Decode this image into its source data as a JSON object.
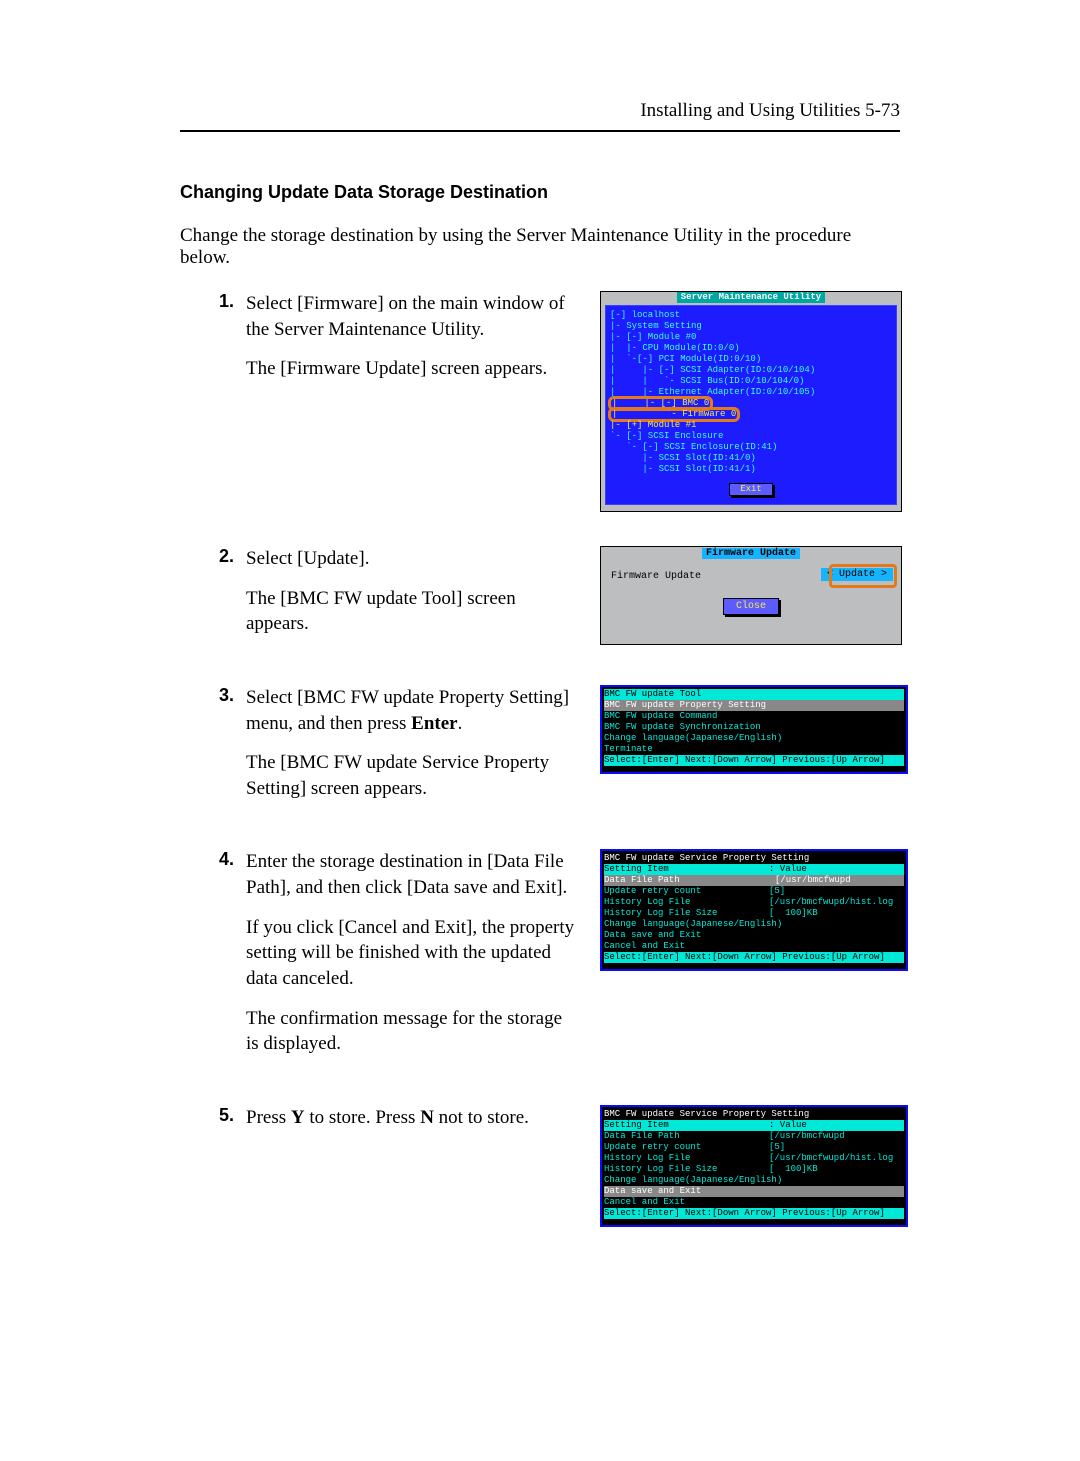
{
  "header": {
    "text": "Installing and Using Utilities    5-73"
  },
  "section_title": "Changing Update Data Storage Destination",
  "intro": "Change the storage destination by using the Server Maintenance Utility in the procedure below.",
  "steps": [
    {
      "num": "1.",
      "paras": [
        "Select [Firmware] on the main window of the Server Maintenance Utility.",
        "The [Firmware Update] screen appears."
      ]
    },
    {
      "num": "2.",
      "paras": [
        "Select [Update].",
        "The [BMC FW update Tool] screen appears."
      ]
    },
    {
      "num": "3.",
      "paras": [
        "Select [BMC FW update Property Setting] menu, and then press Enter.",
        "The [BMC FW update Service Property Setting] screen appears."
      ]
    },
    {
      "num": "4.",
      "paras": [
        "Enter the storage destination in [Data File Path], and then click [Data save and Exit].",
        "If you click [Cancel and Exit], the property setting will be finished with the updated data canceled.",
        "The confirmation message for the storage is displayed."
      ]
    },
    {
      "num": "5.",
      "paras": [
        "Press Y to store. Press N not to store."
      ]
    }
  ],
  "fig1": {
    "title": " Server Maintenance Utility ",
    "exit": "Exit",
    "tree": [
      {
        "txt": "[-] localhost",
        "cls": "tcy"
      },
      {
        "txt": "|- System Setting",
        "cls": "tcy"
      },
      {
        "txt": "|- [-] Module #0",
        "cls": "tcy"
      },
      {
        "txt": "|  |- CPU Module(ID:0/0)",
        "cls": "tcy"
      },
      {
        "txt": "|  `-[-] PCI Module(ID:0/10)",
        "cls": "tcy"
      },
      {
        "txt": "|     |- [-] SCSI Adapter(ID:0/10/104)",
        "cls": "tcy"
      },
      {
        "txt": "|     |   `- SCSI Bus(ID:0/10/104/0)",
        "cls": "tcy"
      },
      {
        "txt": "|     |- Ethernet Adapter(ID:0/10/105)",
        "cls": "tcy"
      },
      {
        "txt": "|     |- [-] BMC 0",
        "cls": "ty",
        "hl": true
      },
      {
        "txt": "|         `- Firmware 0",
        "cls": "ty",
        "hl_cont": true
      },
      {
        "txt": "|- [+] Module #1",
        "cls": "ty"
      },
      {
        "txt": "`- [-] SCSI Enclosure",
        "cls": "tcy"
      },
      {
        "txt": "   `- [-] SCSI Enclosure(ID:41)",
        "cls": "tcy"
      },
      {
        "txt": "      |- SCSI Slot(ID:41/0)",
        "cls": "tcy"
      },
      {
        "txt": "      |- SCSI Slot(ID:41/1)",
        "cls": "tcy"
      }
    ]
  },
  "fig2": {
    "title": " Firmware Update ",
    "label": "Firmware Update",
    "update": "< Update >",
    "close": "Close"
  },
  "fig3": {
    "title": "BMC FW update Tool",
    "rows": [
      {
        "txt": "BMC FW update Property Setting",
        "sel": true
      },
      {
        "txt": "BMC FW update Command"
      },
      {
        "txt": "BMC FW update Synchronization"
      },
      {
        "txt": "Change language(Japanese/English)"
      },
      {
        "txt": "Terminate"
      }
    ],
    "footer": "Select:[Enter] Next:[Down Arrow] Previous:[Up Arrow]"
  },
  "fig4": {
    "title": "BMC FW update Service Property Setting",
    "header_left": "Setting Item",
    "header_right": ": Value",
    "rows": [
      {
        "l": "Data File Path",
        "r": "[/usr/bmcfwupd",
        "sel": true,
        "cursor": true
      },
      {
        "l": "Update retry count",
        "r": "[5]"
      },
      {
        "l": "History Log File",
        "r": "[/usr/bmcfwupd/hist.log"
      },
      {
        "l": "History Log File Size",
        "r": "[  100]KB"
      },
      {
        "l": "Change language(Japanese/English)",
        "r": ""
      },
      {
        "l": "Data save and Exit",
        "r": ""
      },
      {
        "l": "Cancel and Exit",
        "r": ""
      }
    ],
    "footer": "Select:[Enter] Next:[Down Arrow] Previous:[Up Arrow]"
  },
  "fig5": {
    "title": "BMC FW update Service Property Setting",
    "header_left": "Setting Item",
    "header_right": ": Value",
    "rows": [
      {
        "l": "Data File Path",
        "r": "[/usr/bmcfwupd"
      },
      {
        "l": "Update retry count",
        "r": "[5]"
      },
      {
        "l": "History Log File",
        "r": "[/usr/bmcfwupd/hist.log"
      },
      {
        "l": "History Log File Size",
        "r": "[  100]KB"
      },
      {
        "l": "Change language(Japanese/English)",
        "r": ""
      },
      {
        "l": "Data save and Exit",
        "r": "",
        "sel": true,
        "cursor": true
      },
      {
        "l": "Cancel and Exit",
        "r": ""
      }
    ],
    "footer": "Select:[Enter] Next:[Down Arrow] Previous:[Up Arrow]"
  }
}
